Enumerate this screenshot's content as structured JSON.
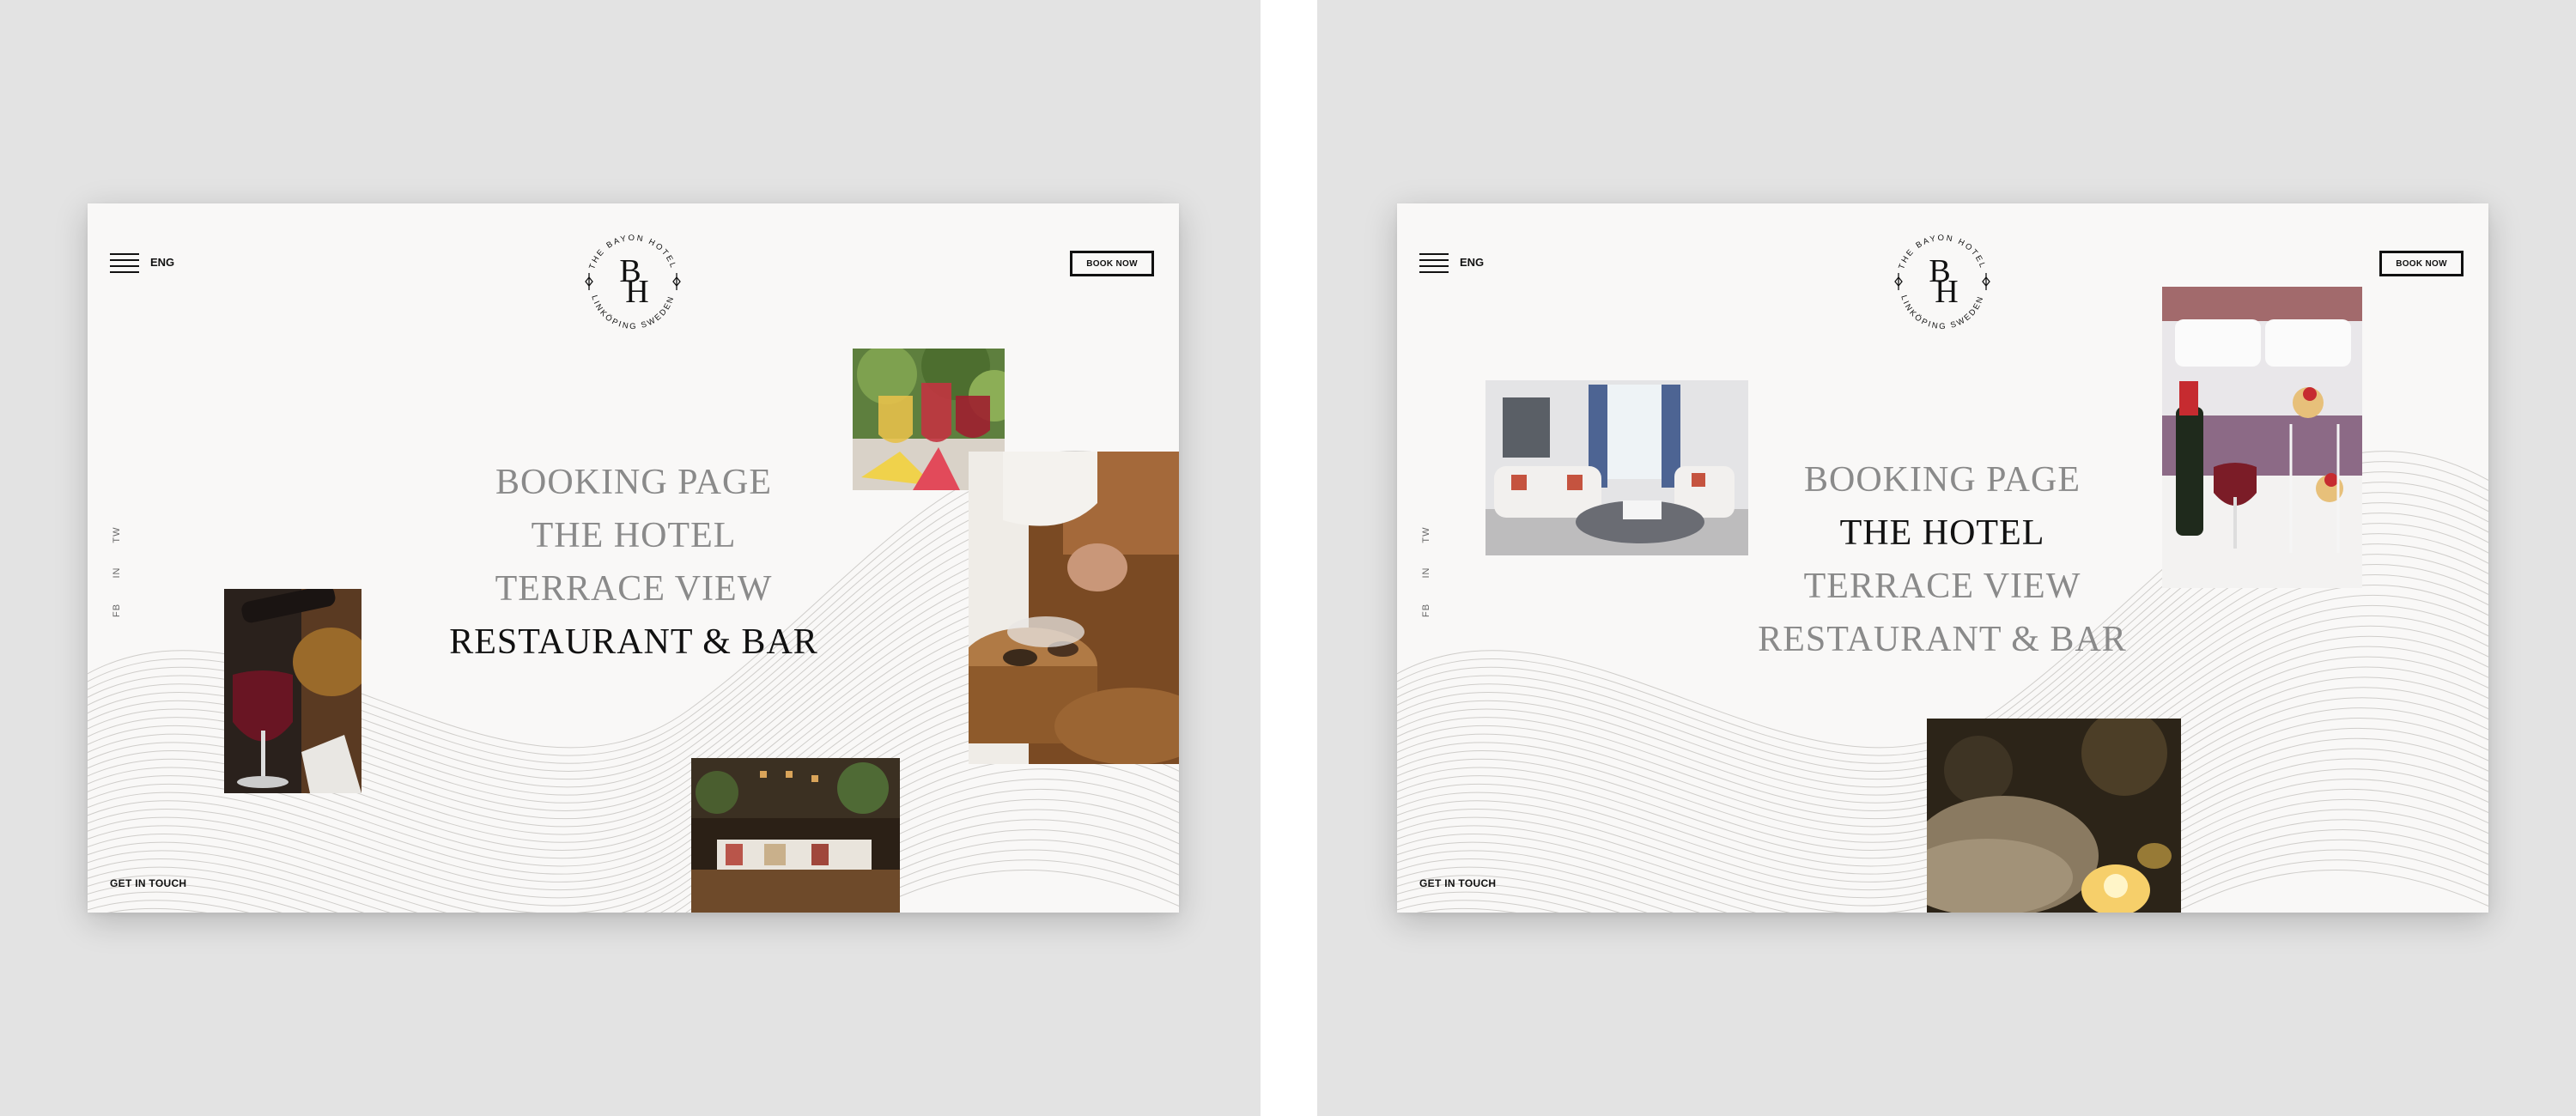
{
  "logo": {
    "arc_top": "THE BAYON HOTEL",
    "arc_bottom": "LINKÖPING SWEDEN",
    "monogram_b": "B",
    "monogram_h": "H"
  },
  "header": {
    "language": "ENG",
    "book_now": "BOOK NOW"
  },
  "footer": {
    "get_in_touch": "GET IN TOUCH"
  },
  "social": [
    "TW",
    "IN",
    "FB"
  ],
  "nav_items": [
    "BOOKING PAGE",
    "THE HOTEL",
    "TERRACE VIEW",
    "RESTAURANT & BAR"
  ],
  "left_screen": {
    "active_item": "RESTAURANT & BAR"
  },
  "right_screen": {
    "active_item": "THE HOTEL"
  },
  "colors": {
    "text_active": "#111111",
    "text_inactive": "#8a8a8a",
    "page_bg": "#f9f8f7",
    "canvas_bg": "#e3e3e3"
  }
}
